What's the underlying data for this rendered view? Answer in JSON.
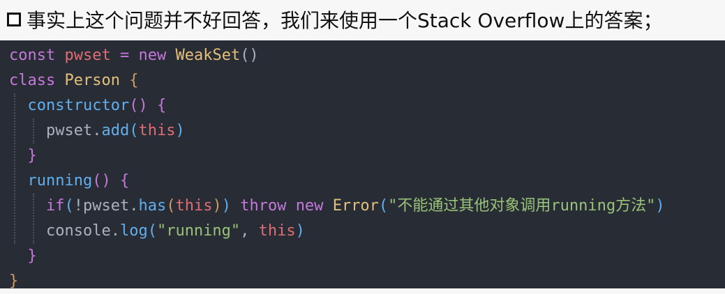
{
  "header": {
    "text": "事实上这个问题并不好回答，我们来使用一个Stack Overflow上的答案；"
  },
  "code": {
    "l1": {
      "kw_const": "const",
      "var": "pwset",
      "eq": "=",
      "kw_new": "new",
      "cls": "WeakSet",
      "parens": "()"
    },
    "l2": {
      "kw_class": "class",
      "cls": "Person",
      "brace": "{"
    },
    "l3": {
      "fn": "constructor",
      "parens": "()",
      "brace": "{"
    },
    "l4": {
      "obj": "pwset",
      "dot": ".",
      "fn": "add",
      "po": "(",
      "this": "this",
      "pc": ")"
    },
    "l5": {
      "brace": "}"
    },
    "l6": {
      "fn": "running",
      "parens": "()",
      "brace": "{"
    },
    "l7": {
      "kw_if": "if",
      "po1": "(",
      "bang": "!",
      "obj": "pwset",
      "dot": ".",
      "fn": "has",
      "po2": "(",
      "this": "this",
      "pc2": ")",
      "pc1": ")",
      "kw_throw": "throw",
      "kw_new": "new",
      "cls": "Error",
      "po3": "(",
      "str": "\"不能通过其他对象调用running方法\"",
      "pc3": ")"
    },
    "l8": {
      "obj": "console",
      "dot": ".",
      "fn": "log",
      "po": "(",
      "str": "\"running\"",
      "comma": ",",
      "this": "this",
      "pc": ")"
    },
    "l9": {
      "brace": "}"
    },
    "l10": {
      "brace": "}"
    }
  }
}
